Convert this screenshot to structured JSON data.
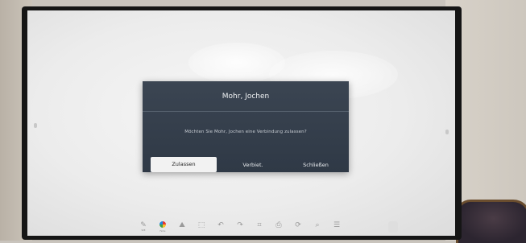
{
  "dialog": {
    "title": "Mohr, Jochen",
    "message": "Möchten Sie Mohr, Jochen eine Verbindung zulassen?",
    "buttons": {
      "allow": "Zulassen",
      "deny": "Verbiet.",
      "close": "Schließen"
    }
  },
  "toolbar": {
    "items": [
      {
        "icon": "pen-icon",
        "label": "Stift"
      },
      {
        "icon": "color-icon",
        "label": "Farbe"
      },
      {
        "icon": "shapes-icon",
        "label": ""
      },
      {
        "icon": "select-icon",
        "label": ""
      },
      {
        "icon": "undo-icon",
        "label": ""
      },
      {
        "icon": "redo-icon",
        "label": ""
      },
      {
        "icon": "frame-icon",
        "label": ""
      },
      {
        "icon": "import-icon",
        "label": ""
      },
      {
        "icon": "share-icon",
        "label": ""
      },
      {
        "icon": "zoom-icon",
        "label": ""
      },
      {
        "icon": "menu-icon",
        "label": ""
      }
    ]
  }
}
